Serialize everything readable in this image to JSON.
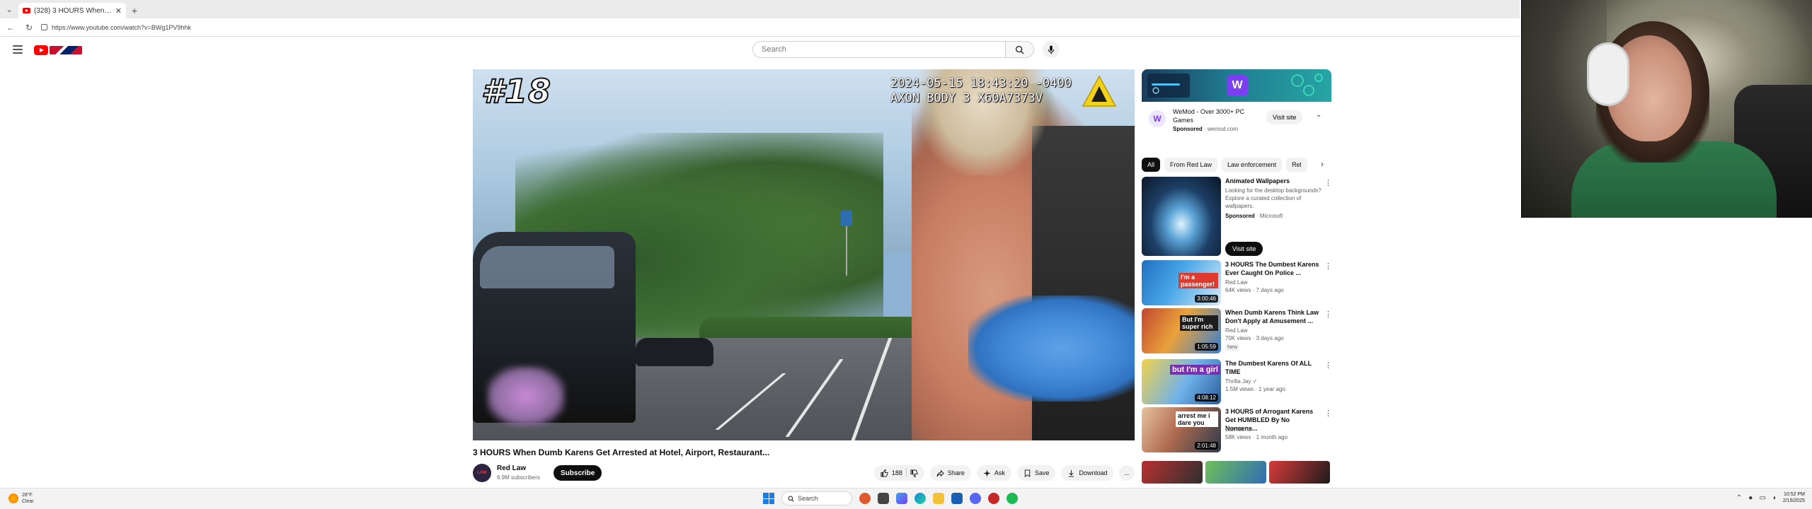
{
  "browser": {
    "tab_title": "(328) 3 HOURS When Dumb Karens ...",
    "url": "https://www.youtube.com/watch?v=BWg1PV9hhk",
    "new_tab_label": "+"
  },
  "masthead": {
    "search_placeholder": "Search"
  },
  "player": {
    "episode_overlay": "#18",
    "bodycam_stamp": "2024-05-15 18:43:20 -0400\nAXON BODY 3 X60A7373V"
  },
  "video": {
    "title": "3 HOURS When Dumb Karens Get Arrested at Hotel, Airport, Restaurant...",
    "channel_name": "Red Law",
    "channel_avatar_text": "LAW",
    "channel_subs": "6.9M subscribers",
    "subscribe_label": "Subscribe",
    "like_count": "188",
    "share_label": "Share",
    "ask_label": "Ask",
    "save_label": "Save",
    "download_label": "Download",
    "more_label": "..."
  },
  "ad": {
    "title": "WeMod - Over 3000+ PC Games",
    "sponsored": "Sponsored",
    "domain": "wemod.com",
    "visit_label": "Visit site",
    "logo_letter": "W"
  },
  "chips": [
    "All",
    "From Red Law",
    "Law enforcement",
    "Rel"
  ],
  "recommendations": [
    {
      "title": "Animated Wallpapers",
      "desc": "Looking for the desktop backgrounds? Explore a curated collection of wallpapers.",
      "sponsored": "Sponsored",
      "advertiser": "Microsoft",
      "visit_label": "Visit site"
    },
    {
      "title": "3 HOURS The Dumbest Karens Ever Caught On Police ...",
      "channel": "Red Law",
      "stats": "64K views · 7 days ago",
      "duration": "3:00:46",
      "thumb_text": "I'm a passenger!"
    },
    {
      "title": "When Dumb Karens Think Law Don't Apply at Amusement ...",
      "channel": "Red Law",
      "stats": "70K views · 3 days ago",
      "badge": "New",
      "duration": "1:05:59",
      "thumb_text": "But I'm super rich"
    },
    {
      "title": "The Dumbest Karens Of ALL TIME",
      "channel": "Thrilla Jay",
      "stats": "1.5M views · 1 year ago",
      "duration": "4:08:12",
      "thumb_text": "but I'm a girl"
    },
    {
      "title": "3 HOURS of Arrogant Karens Get HUMBLED By No Nonsens...",
      "channel": "Law Mirror",
      "stats": "58K views · 1 month ago",
      "duration": "2:01:48",
      "thumb_text": "arrest me i dare you"
    }
  ],
  "taskbar": {
    "weather_temp": "28°F",
    "weather_cond": "Clear",
    "search_label": "Search",
    "time": "10:52 PM",
    "date": "2/15/2025"
  },
  "colors": {
    "yt_red": "#ff0000",
    "subscribe_bg": "#0f0f0f",
    "chip_bg": "#f2f2f2"
  }
}
